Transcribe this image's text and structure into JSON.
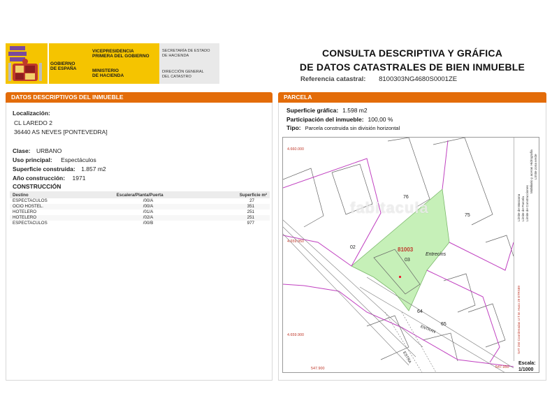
{
  "header": {
    "gov_left_top": "GOBIERNO",
    "gov_left_bottom": "DE ESPAÑA",
    "vice_line1": "VICEPRESIDENCIA",
    "vice_line2": "PRIMERA DEL GOBIERNO",
    "min_line1": "MINISTERIO",
    "min_line2": "DE HACIENDA",
    "sec_line1": "SECRETARÍA DE ESTADO",
    "sec_line2": "DE HACIENDA",
    "dir_line1": "DIRECCIÓN GENERAL",
    "dir_line2": "DEL CATASTRO",
    "title_line1": "CONSULTA DESCRIPTIVA Y GRÁFICA",
    "title_line2": "DE DATOS CATASTRALES DE BIEN INMUEBLE",
    "ref_label": "Referencia catastral:",
    "ref_value": "8100303NG4680S0001ZE"
  },
  "left": {
    "bar_title": "DATOS DESCRIPTIVOS DEL INMUEBLE",
    "loc_label": "Localización:",
    "addr1": "CL LAREDO 2",
    "addr2": "36440 AS NEVES [PONTEVEDRA]",
    "clase_label": "Clase:",
    "clase_value": "URBANO",
    "uso_label": "Uso principal:",
    "uso_value": "Espectáculos",
    "sup_label": "Superficie construida:",
    "sup_value": "1.857 m2",
    "anio_label": "Año construcción:",
    "anio_value": "1971",
    "constr_title": "CONSTRUCCIÓN",
    "table_headers": [
      "Destino",
      "Escalera/Planta/Puerta",
      "Superficie m²"
    ],
    "rows": [
      [
        "ESPECTACULOS",
        "/00/A",
        "27"
      ],
      [
        "OCIO HOSTEL.",
        "/00/A",
        "351"
      ],
      [
        "HOTELERO",
        "/01/A",
        "251"
      ],
      [
        "HOTELERO",
        "/02/A",
        "251"
      ],
      [
        "ESPECTACULOS",
        "/00/B",
        "977"
      ]
    ]
  },
  "right": {
    "bar_title": "PARCELA",
    "sup_label": "Superficie gráfica:",
    "sup_value": "1.598 m2",
    "part_label": "Participación del inmueble:",
    "part_value": "100,00 %",
    "tipo_label": "Tipo:",
    "tipo_value": "Parcela construida sin división horizontal",
    "coords": {
      "y1": "4.660.000",
      "y2": "4.659.950",
      "y3": "4.659.900",
      "x1": "547.900",
      "x2": "547.950"
    },
    "labels": {
      "p76": "76",
      "p75": "75",
      "p02": "02",
      "p03": "03",
      "p64": "64",
      "p65": "65",
      "code": "81003",
      "entrecins": "Entrecins",
      "street1": "ENTRAN",
      "street2": "ESTRA"
    },
    "legend": [
      "Límite de Manzana",
      "Límite de Parcela",
      "Límite de Construcciones",
      "Mobiliario y aceras",
      "Límite zona verde",
      "Hidrografía"
    ],
    "legend_foot": "SAT 250 Coordenadas U.T.M. Huso 29 ETRS89",
    "scale_label": "Escala:",
    "scale_value": "1/1000",
    "watermark": "fabitacula"
  },
  "colors": {
    "accent": "#e36c09",
    "parcel_fill": "#c6f0b8",
    "boundary": "#c040c0"
  }
}
